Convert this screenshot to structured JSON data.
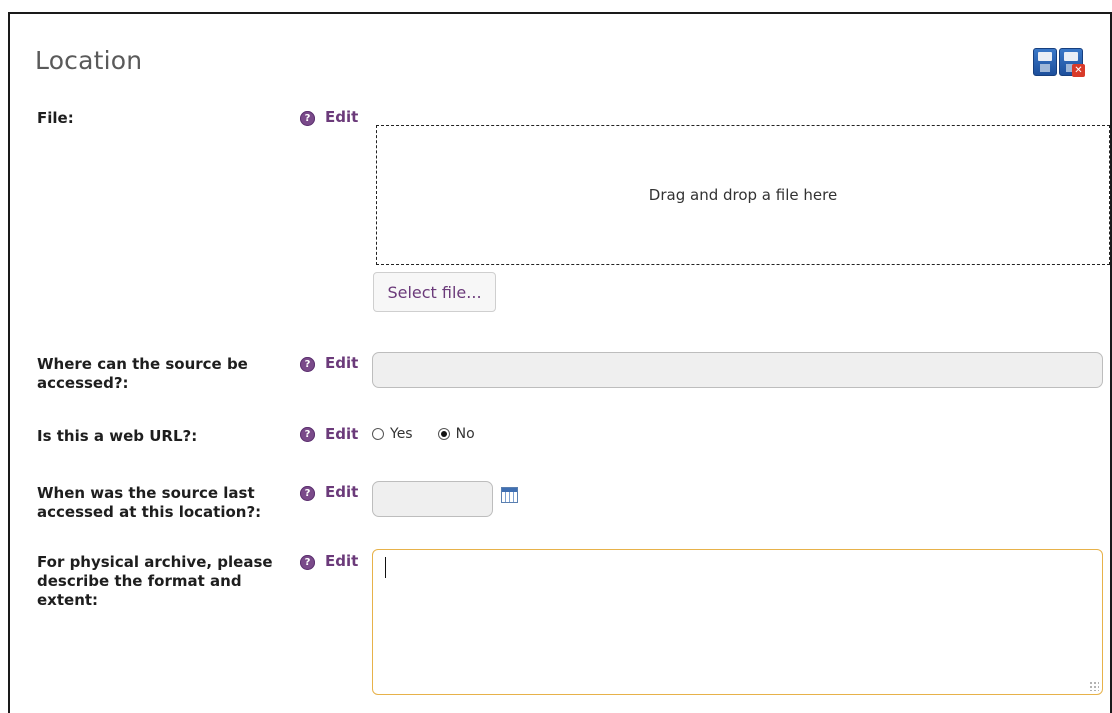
{
  "section": {
    "title": "Location"
  },
  "toolbar": {
    "save_icon": "save-disk-icon",
    "discard_icon": "save-disk-cancel-icon"
  },
  "fields": [
    {
      "label": "File:",
      "help_icon": "?",
      "edit_label": "Edit",
      "dropzone_text": "Drag and drop a file here",
      "select_button": "Select file..."
    },
    {
      "label": "Where can the source be accessed?:",
      "help_icon": "?",
      "edit_label": "Edit",
      "value": ""
    },
    {
      "label": "Is this a web URL?:",
      "help_icon": "?",
      "edit_label": "Edit",
      "options": [
        "Yes",
        "No"
      ],
      "selected": "No"
    },
    {
      "label": "When was the source last accessed at this location?:",
      "help_icon": "?",
      "edit_label": "Edit",
      "value": "",
      "calendar_icon": "calendar-icon"
    },
    {
      "label": "For physical archive, please describe the format and extent:",
      "help_icon": "?",
      "edit_label": "Edit",
      "value": ""
    }
  ],
  "colors": {
    "edit_link": "#6b3a7a",
    "focus_border": "#e7b24a",
    "input_bg": "#efefef"
  }
}
